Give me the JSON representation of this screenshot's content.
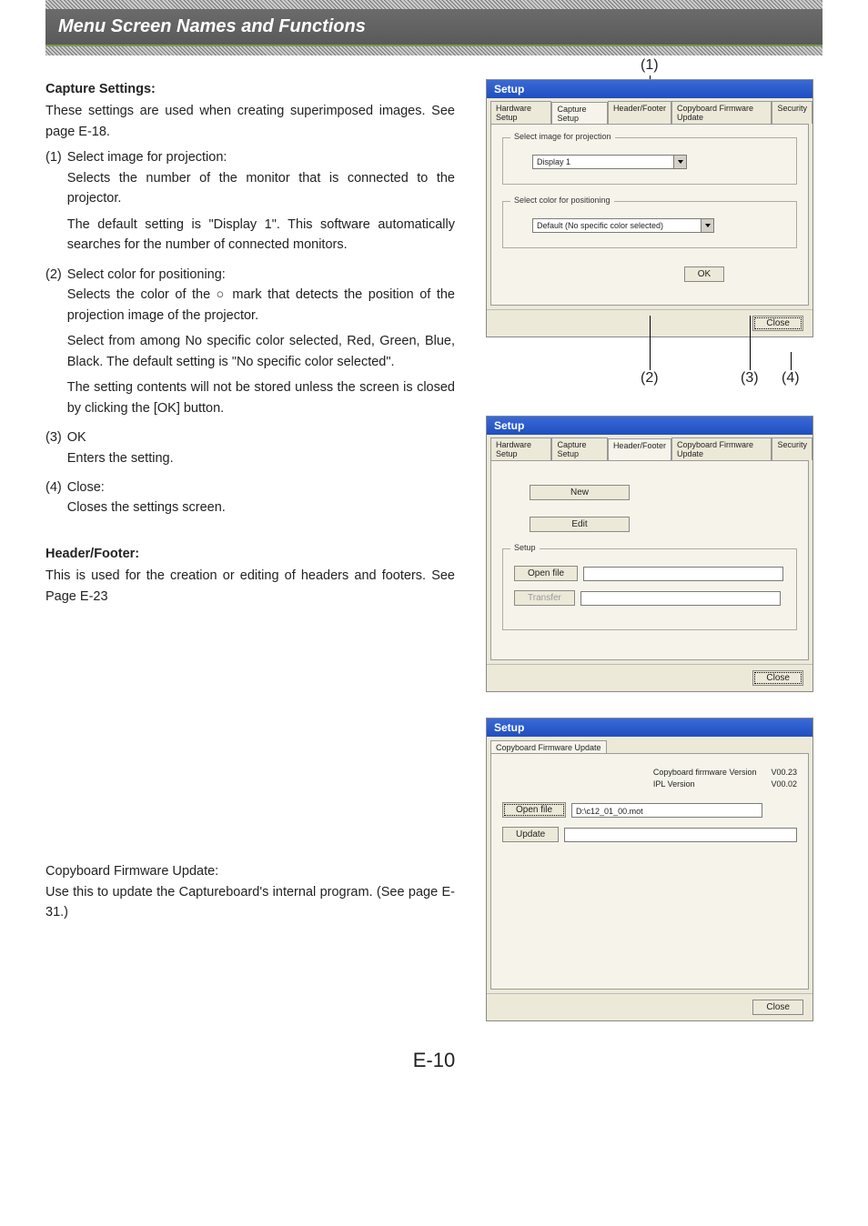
{
  "header": {
    "title": "Menu Screen Names and Functions"
  },
  "capture": {
    "heading": "Capture Settings:",
    "intro": "These settings are used when creating superimposed images. See page E-18.",
    "items": [
      {
        "num": "(1)",
        "title": "Select image for projection:",
        "body1": "Selects the number of the monitor that is connected to the projector.",
        "body2": "The default setting is \"Display 1\". This software automatically searches for the number of connected monitors."
      },
      {
        "num": "(2)",
        "title": "Select color for positioning:",
        "body1": "Selects the color of the ○ mark that detects the position of the projection image of the projector.",
        "body2": "Select from among No specific color selected, Red, Green, Blue, Black. The default setting is \"No specific color selected\".",
        "body3": "The setting contents will not be stored unless the screen is closed by clicking the [OK] button."
      },
      {
        "num": "(3)",
        "title": "OK",
        "body1": "Enters the setting."
      },
      {
        "num": "(4)",
        "title": "Close:",
        "body1": "Closes the settings screen."
      }
    ]
  },
  "headerfooter": {
    "heading": "Header/Footer:",
    "body": "This is used for the creation or editing of headers and footers. See Page E-23"
  },
  "firmware": {
    "heading": "Copyboard Firmware Update:",
    "body": "Use this to update the Captureboard's internal program. (See page E-31.)"
  },
  "dlg_common": {
    "title": "Setup",
    "tabs": {
      "hw": "Hardware Setup",
      "cap": "Capture Setup",
      "hf": "Header/Footer",
      "fw": "Copyboard Firmware Update",
      "sec": "Security"
    },
    "close": "Close",
    "ok": "OK"
  },
  "dlg1": {
    "group1_label": "Select image for projection",
    "dd1_value": "Display 1",
    "group2_label": "Select color for positioning",
    "dd2_value": "Default (No specific color selected)",
    "callouts": {
      "c1": "(1)",
      "c2": "(2)",
      "c3": "(3)",
      "c4": "(4)"
    }
  },
  "dlg2": {
    "btn_new": "New",
    "btn_edit": "Edit",
    "group_label": "Setup",
    "btn_open": "Open file",
    "btn_transfer": "Transfer"
  },
  "dlg3": {
    "ver_label1": "Copyboard firmware Version",
    "ver_val1": "V00.23",
    "ver_label2": "IPL Version",
    "ver_val2": "V00.02",
    "btn_open": "Open file",
    "file_value": "D:\\c12_01_00.mot",
    "btn_update": "Update"
  },
  "pagenum": "E-10"
}
